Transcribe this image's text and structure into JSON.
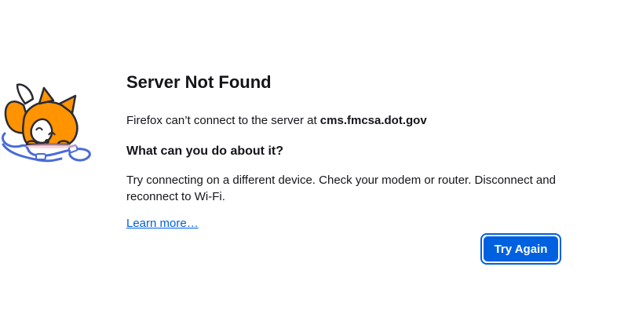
{
  "error": {
    "title": "Server Not Found",
    "intro_prefix": "Firefox can’t connect to the server at ",
    "host": "cms.fmcsa.dot.gov",
    "subheading": "What can you do about it?",
    "advice_line1": "Try connecting on a different device. Check your modem or router. Disconnect and",
    "advice_line2": "reconnect to Wi-Fi.",
    "learn_more": "Learn more…"
  },
  "actions": {
    "try_again_label": "Try Again"
  },
  "illustration": {
    "icon": "fox-tangled-cable-icon"
  },
  "colors": {
    "accent": "#0061e0",
    "text": "#15141a",
    "fox_orange": "#ff9400",
    "cable_blue": "#4a6bd8"
  }
}
